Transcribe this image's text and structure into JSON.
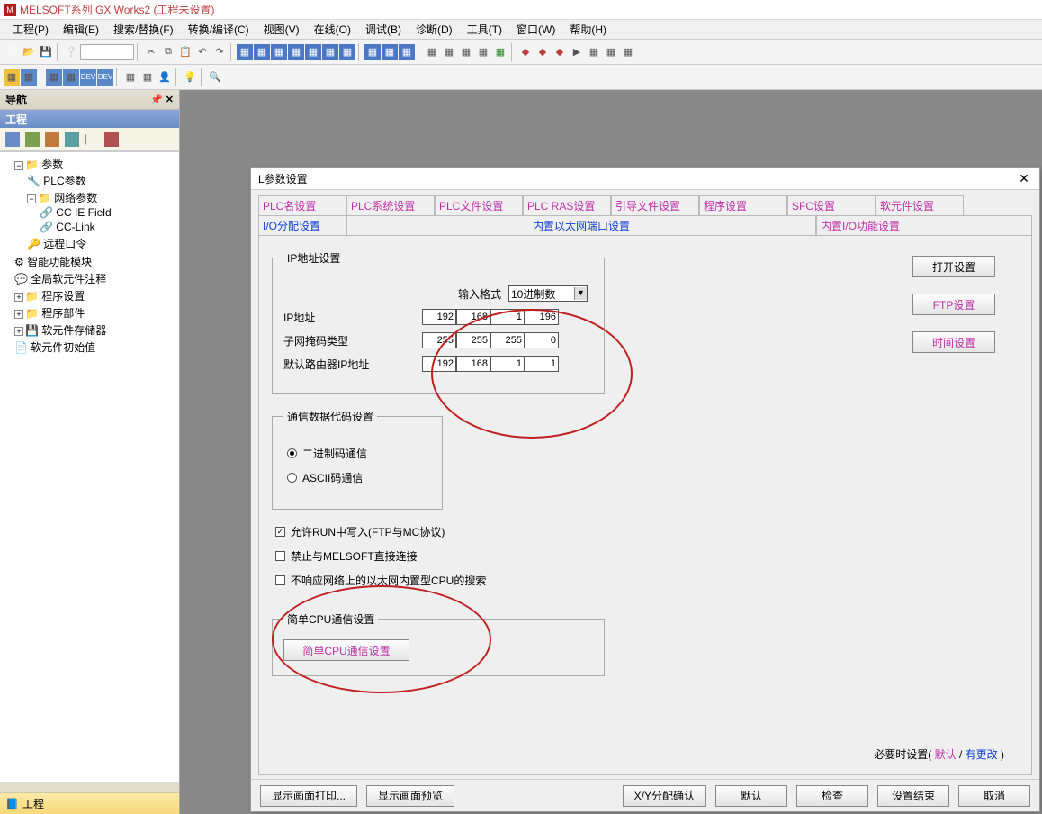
{
  "app": {
    "title": "MELSOFT系列 GX Works2 (工程未设置)"
  },
  "menu": [
    "工程(P)",
    "编辑(E)",
    "搜索/替换(F)",
    "转换/编译(C)",
    "视图(V)",
    "在线(O)",
    "调试(B)",
    "诊断(D)",
    "工具(T)",
    "窗口(W)",
    "帮助(H)"
  ],
  "nav": {
    "title": "导航",
    "subtitle": "工程",
    "tree": {
      "root": "参数",
      "plc_params": "PLC参数",
      "net_params": "网络参数",
      "cc_ie": "CC IE Field",
      "cc_link": "CC-Link",
      "remote_pw": "远程口令",
      "smart_mod": "智能功能模块",
      "global_comment": "全局软元件注释",
      "prog_set": "程序设置",
      "prog_parts": "程序部件",
      "dev_store": "软元件存储器",
      "dev_init": "软元件初始值"
    },
    "footer_tab": "工程"
  },
  "dialog": {
    "title": "L参数设置",
    "tabs_row1": [
      "PLC名设置",
      "PLC系统设置",
      "PLC文件设置",
      "PLC RAS设置",
      "引导文件设置",
      "程序设置",
      "SFC设置",
      "软元件设置"
    ],
    "tabs_row2_left": "I/O分配设置",
    "tabs_row2_mid": "内置以太网端口设置",
    "tabs_row2_right": "内置I/O功能设置",
    "ip_group": "IP地址设置",
    "input_fmt_label": "输入格式",
    "input_fmt_value": "10进制数",
    "ip_label": "IP地址",
    "ip": [
      "192",
      "168",
      "1",
      "196"
    ],
    "mask_label": "子网掩码类型",
    "mask": [
      "255",
      "255",
      "255",
      "0"
    ],
    "gw_label": "默认路由器IP地址",
    "gw": [
      "192",
      "168",
      "1",
      "1"
    ],
    "side_btns": {
      "open": "打开设置",
      "ftp": "FTP设置",
      "time": "时间设置"
    },
    "comm_group": "通信数据代码设置",
    "radio_bin": "二进制码通信",
    "radio_ascii": "ASCII码通信",
    "chk_run": "允许RUN中写入(FTP与MC协议)",
    "chk_forbid": "禁止与MELSOFT直接连接",
    "chk_nosearch": "不响应网络上的以太网内置型CPU的搜索",
    "simple_group": "简单CPU通信设置",
    "simple_btn": "简单CPU通信设置",
    "footer_note_prefix": "必要时设置(",
    "footer_note_default": "默认",
    "footer_note_sep": " / ",
    "footer_note_changed": "有更改",
    "footer_note_suffix": " )",
    "buttons": {
      "print": "显示画面打印...",
      "preview": "显示画面预览",
      "xy": "X/Y分配确认",
      "default": "默认",
      "check": "检查",
      "end": "设置结束",
      "cancel": "取消"
    }
  }
}
